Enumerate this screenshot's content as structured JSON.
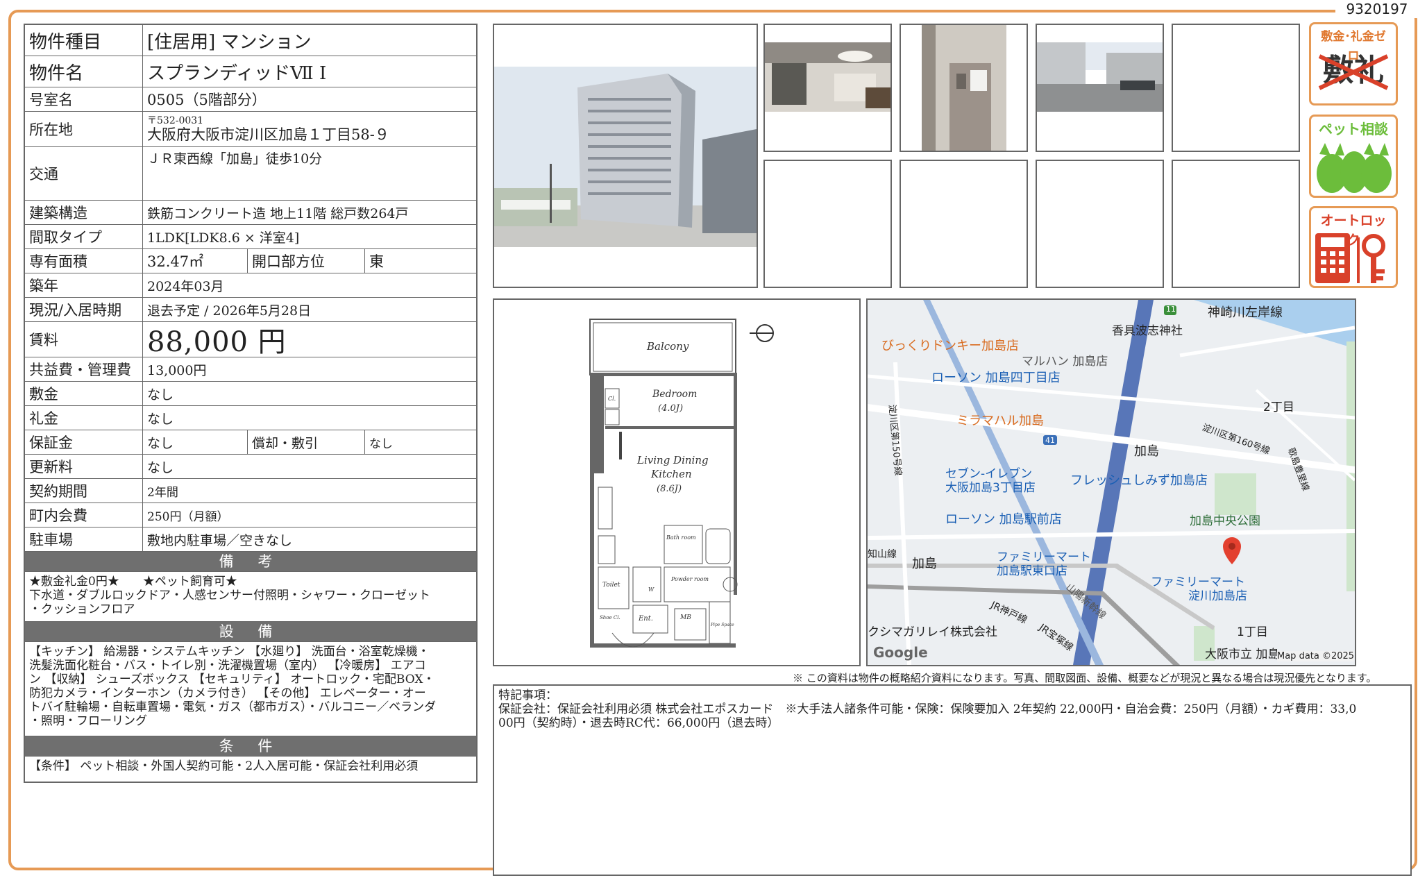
{
  "document_id": "9320197",
  "spec": {
    "property_type_label": "物件種目",
    "property_type": "[住居用] マンション",
    "name_label": "物件名",
    "name": "スプランディッドⅦ I",
    "room_label": "号室名",
    "room": "0505（5階部分）",
    "address_label": "所在地",
    "postal": "〒532-0031",
    "address": "大阪府大阪市淀川区加島１丁目58-９",
    "transport_label": "交通",
    "transport": "ＪＲ東西線「加島」徒歩10分",
    "structure_label": "建築構造",
    "structure": "鉄筋コンクリート造 地上11階 総戸数264戸",
    "layout_label": "間取タイプ",
    "layout": "1LDK[LDK8.6 × 洋室4]",
    "area_label": "専有面積",
    "area": "32.47㎡",
    "orientation_label": "開口部方位",
    "orientation": "東",
    "built_label": "築年",
    "built": "2024年03月",
    "status_label": "現況/入居時期",
    "status": "退去予定 / 2026年5月28日",
    "rent_label": "賃料",
    "rent": "88,000 円",
    "fee_label": "共益費・管理費",
    "fee": "13,000円",
    "deposit_label": "敷金",
    "deposit": "なし",
    "key_money_label": "礼金",
    "key_money": "なし",
    "guarantee_label": "保証金",
    "guarantee": "なし",
    "amortization_label": "償却・敷引",
    "amortization": "なし",
    "renewal_label": "更新料",
    "renewal": "なし",
    "contract_label": "契約期間",
    "contract": "2年間",
    "community_label": "町内会費",
    "community": "250円（月額）",
    "parking_label": "駐車場",
    "parking": "敷地内駐車場／空きなし"
  },
  "remarks": {
    "heading": "備 考",
    "line1": "★敷金礼金0円★　　★ペット飼育可★",
    "line2": "下水道・ダブルロックドア・人感センサー付照明・シャワー・クローゼット",
    "line3": "・クッションフロア"
  },
  "equipment": {
    "heading": "設 備",
    "line1": "【キッチン】 給湯器・システムキッチン 【水廻り】 洗面台・浴室乾燥機・",
    "line2": "洗髪洗面化粧台・バス・トイレ別・洗濯機置場（室内） 【冷暖房】 エアコ",
    "line3": "ン 【収納】 シューズボックス 【セキュリティ】 オートロック・宅配BOX・",
    "line4": "防犯カメラ・インターホン（カメラ付き） 【その他】 エレベーター・オー",
    "line5": "トバイ駐輪場・自転車置場・電気・ガス（都市ガス）・バルコニー／ベランダ",
    "line6": "・照明・フローリング"
  },
  "conditions": {
    "heading": "条 件",
    "line1": "【条件】 ペット相談・外国人契約可能・2人入居可能・保証会社利用必須"
  },
  "badges": {
    "zero": "敷金･礼金ゼロ",
    "zero_sub1": "敷",
    "zero_sub2": "礼",
    "pet": "ペット相談",
    "autolock": "オートロック"
  },
  "floorplan": {
    "balcony": "Balcony",
    "bedroom": "Bedroom",
    "bedroom_size": "(4.0J)",
    "ldk1": "Living Dining",
    "ldk2": "Kitchen",
    "ldk_size": "(8.6J)",
    "bath": "Bath room",
    "powder": "Powder room",
    "toilet": "Toilet",
    "ent": "Ent.",
    "mb": "MB",
    "cl": "Cl.",
    "w": "W",
    "shoe": "Shoe Cl.",
    "pipe": "Pipe Space"
  },
  "map": {
    "l1": "神崎川左岸線",
    "l2": "香具波志神社",
    "l3": "びっくりドンキー加島店",
    "l4": "マルハン 加島店",
    "l5": "ローソン 加島四丁目店",
    "l6": "ミラマハル加島",
    "l7": "2丁目",
    "l8": "淀川区第160号線",
    "l9": "加島",
    "l10": "セブン-イレブン",
    "l11": "大阪加島3丁目店",
    "l12": "フレッシュしみず加島店",
    "l13": "ローソン 加島駅前店",
    "l14": "加島中央公園",
    "l15": "ファミリーマート",
    "l16": "加島駅東口店",
    "l17": "ファミリーマート",
    "l18": "淀川加島店",
    "l19": "JR神戸線",
    "l20": "山陽新幹線",
    "l21": "加島",
    "l22": "1丁目",
    "l23": "クシマガリレイ株式会社",
    "l24": "JR宝塚線",
    "l25": "大阪市立 加島",
    "l26": "Google",
    "l27": "Map data ©2025",
    "l28": "淀川区第150号線",
    "l29": "知山線",
    "l30": "11",
    "l31": "41",
    "l32": "歌島豊里線"
  },
  "disclaimer": "※ この資料は物件の概略紹介資料になります。写真、間取図面、設備、概要などが現況と異なる場合は現況優先となります。",
  "special": {
    "heading": "特記事項：",
    "line1": "保証会社：保証会社利用必須 株式会社エポスカード　※大手法人諸条件可能・保険：保険要加入 2年契約 22,000円・自治会費：250円（月額）・カギ費用：33,0",
    "line2": "00円（契約時）・退去時RC代：66,000円（退去時）"
  },
  "colors": {
    "frame": "#e69a55",
    "header_bar": "#6f6f6f",
    "badge_green": "#6cbd3b",
    "badge_red": "#d9412a",
    "map_pin": "#e3402f",
    "map_highway": "#5876b8"
  }
}
